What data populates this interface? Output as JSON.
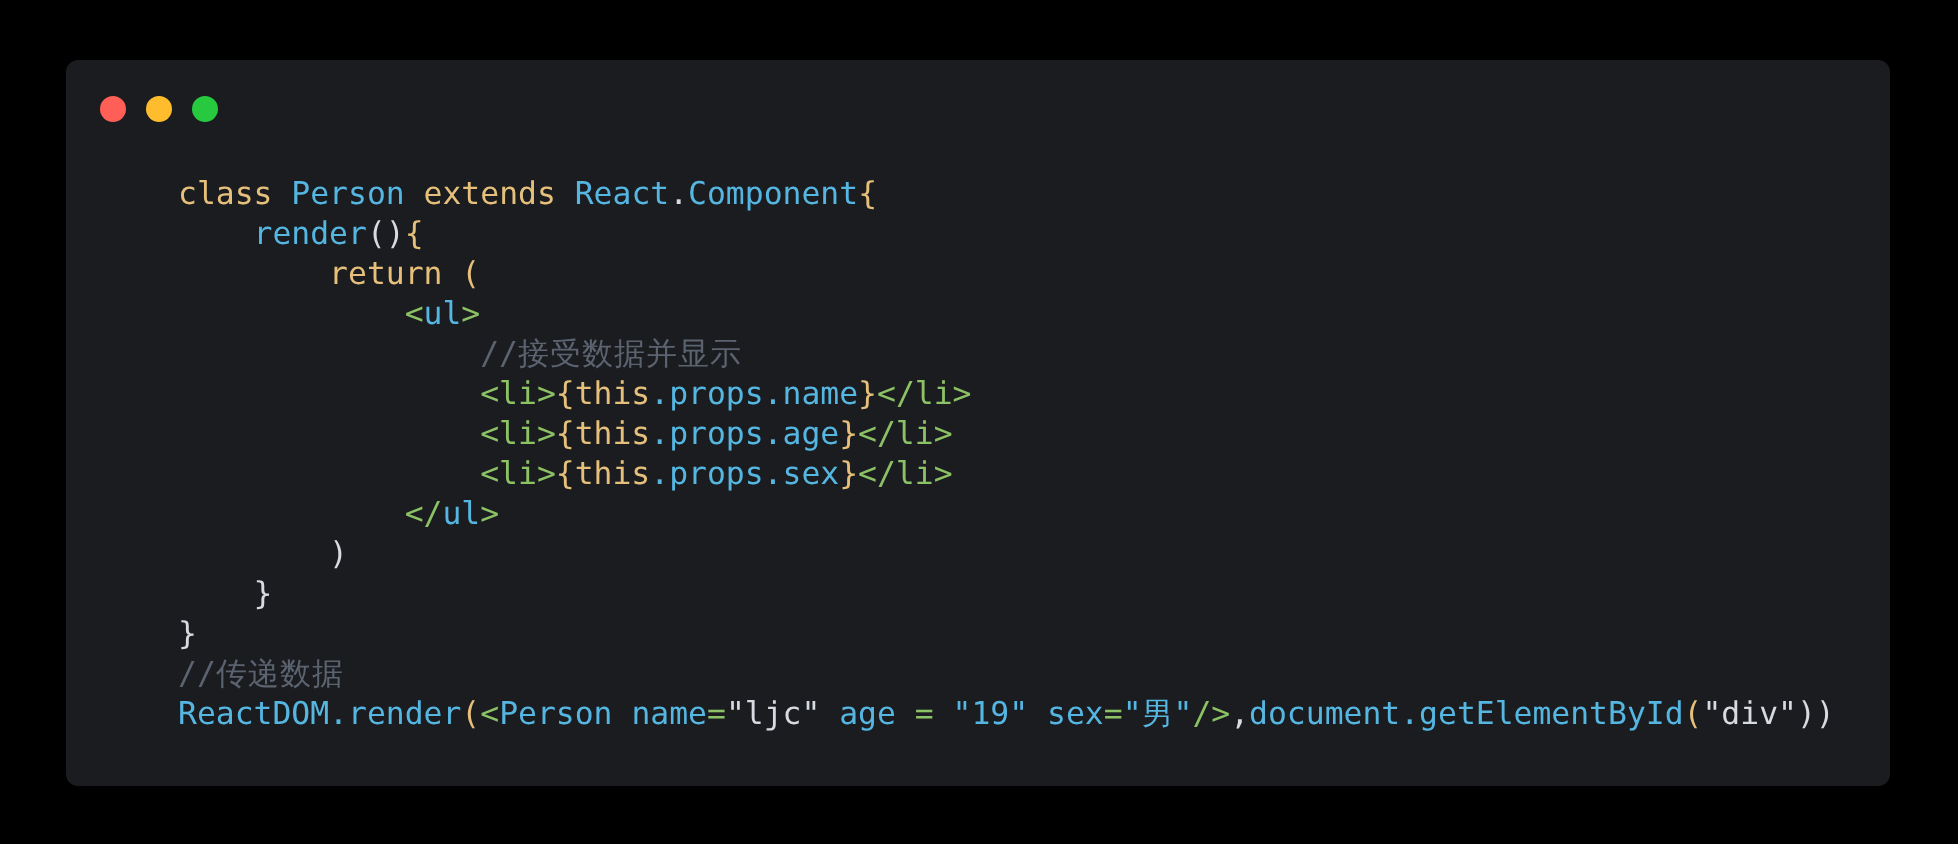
{
  "code_lines": [
    {
      "tokens": [
        {
          "kind": "keyword",
          "text": "class "
        },
        {
          "kind": "name",
          "text": "Person "
        },
        {
          "kind": "keyword",
          "text": "extends "
        },
        {
          "kind": "name",
          "text": "React"
        },
        {
          "kind": "plain",
          "text": "."
        },
        {
          "kind": "name",
          "text": "Component"
        },
        {
          "kind": "keyword",
          "text": "{"
        }
      ]
    },
    {
      "tokens": [
        {
          "kind": "name",
          "text": "    render"
        },
        {
          "kind": "plain",
          "text": "()"
        },
        {
          "kind": "keyword",
          "text": "{"
        }
      ]
    },
    {
      "tokens": [
        {
          "kind": "keyword",
          "text": "        return ("
        }
      ]
    },
    {
      "tokens": [
        {
          "kind": "tag",
          "text": "            <"
        },
        {
          "kind": "name",
          "text": "ul"
        },
        {
          "kind": "tag",
          "text": ">"
        }
      ]
    },
    {
      "tokens": [
        {
          "kind": "comment",
          "text": "                //接受数据并显示"
        }
      ]
    },
    {
      "tokens": [
        {
          "kind": "tag",
          "text": "                <li>"
        },
        {
          "kind": "keyword",
          "text": "{this"
        },
        {
          "kind": "name",
          "text": ".props.name"
        },
        {
          "kind": "keyword",
          "text": "}"
        },
        {
          "kind": "tag",
          "text": "</li>"
        }
      ]
    },
    {
      "tokens": [
        {
          "kind": "tag",
          "text": "                <li>"
        },
        {
          "kind": "keyword",
          "text": "{this"
        },
        {
          "kind": "name",
          "text": ".props.age"
        },
        {
          "kind": "keyword",
          "text": "}"
        },
        {
          "kind": "tag",
          "text": "</li>"
        }
      ]
    },
    {
      "tokens": [
        {
          "kind": "tag",
          "text": "                <li>"
        },
        {
          "kind": "keyword",
          "text": "{this"
        },
        {
          "kind": "name",
          "text": ".props.sex"
        },
        {
          "kind": "keyword",
          "text": "}"
        },
        {
          "kind": "tag",
          "text": "</li>"
        }
      ]
    },
    {
      "tokens": [
        {
          "kind": "tag",
          "text": "            </"
        },
        {
          "kind": "name",
          "text": "ul"
        },
        {
          "kind": "tag",
          "text": ">"
        }
      ]
    },
    {
      "tokens": [
        {
          "kind": "plain",
          "text": "        )"
        }
      ]
    },
    {
      "tokens": [
        {
          "kind": "plain",
          "text": "    }"
        }
      ]
    },
    {
      "tokens": [
        {
          "kind": "plain",
          "text": "}"
        }
      ]
    },
    {
      "tokens": [
        {
          "kind": "comment",
          "text": "//传递数据"
        }
      ]
    },
    {
      "tokens": [
        {
          "kind": "name",
          "text": "ReactDOM.render"
        },
        {
          "kind": "keyword",
          "text": "("
        },
        {
          "kind": "tag",
          "text": "<"
        },
        {
          "kind": "name",
          "text": "Person name"
        },
        {
          "kind": "tag",
          "text": "="
        },
        {
          "kind": "plain",
          "text": "\"ljc\" "
        },
        {
          "kind": "name",
          "text": "age"
        },
        {
          "kind": "tag",
          "text": " = "
        },
        {
          "kind": "name",
          "text": "\"19\" sex"
        },
        {
          "kind": "tag",
          "text": "="
        },
        {
          "kind": "name",
          "text": "\"男\""
        },
        {
          "kind": "tag",
          "text": "/>"
        },
        {
          "kind": "plain",
          "text": ","
        },
        {
          "kind": "name",
          "text": "document.getElementById"
        },
        {
          "kind": "keyword",
          "text": "("
        },
        {
          "kind": "plain",
          "text": "\"div\"))"
        }
      ]
    }
  ]
}
